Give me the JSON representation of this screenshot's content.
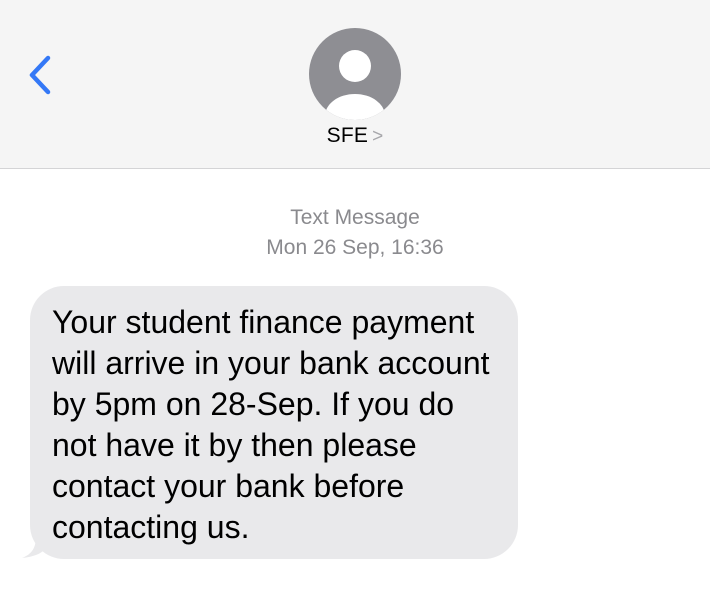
{
  "header": {
    "back_icon": "chevron-left-icon",
    "avatar_icon": "person-silhouette-icon",
    "contact_name": "SFE",
    "contact_chevron": ">",
    "accent_color": "#3478f6",
    "background_color": "#f5f5f5"
  },
  "conversation": {
    "message_type": "Text Message",
    "timestamp": "Mon 26 Sep, 16:36",
    "messages": [
      {
        "direction": "incoming",
        "text": "Your student finance payment will arrive in your bank account by 5pm on 28-Sep. If you do not have it by then please contact your bank before contacting us.",
        "bubble_color": "#e9e9eb"
      }
    ]
  }
}
